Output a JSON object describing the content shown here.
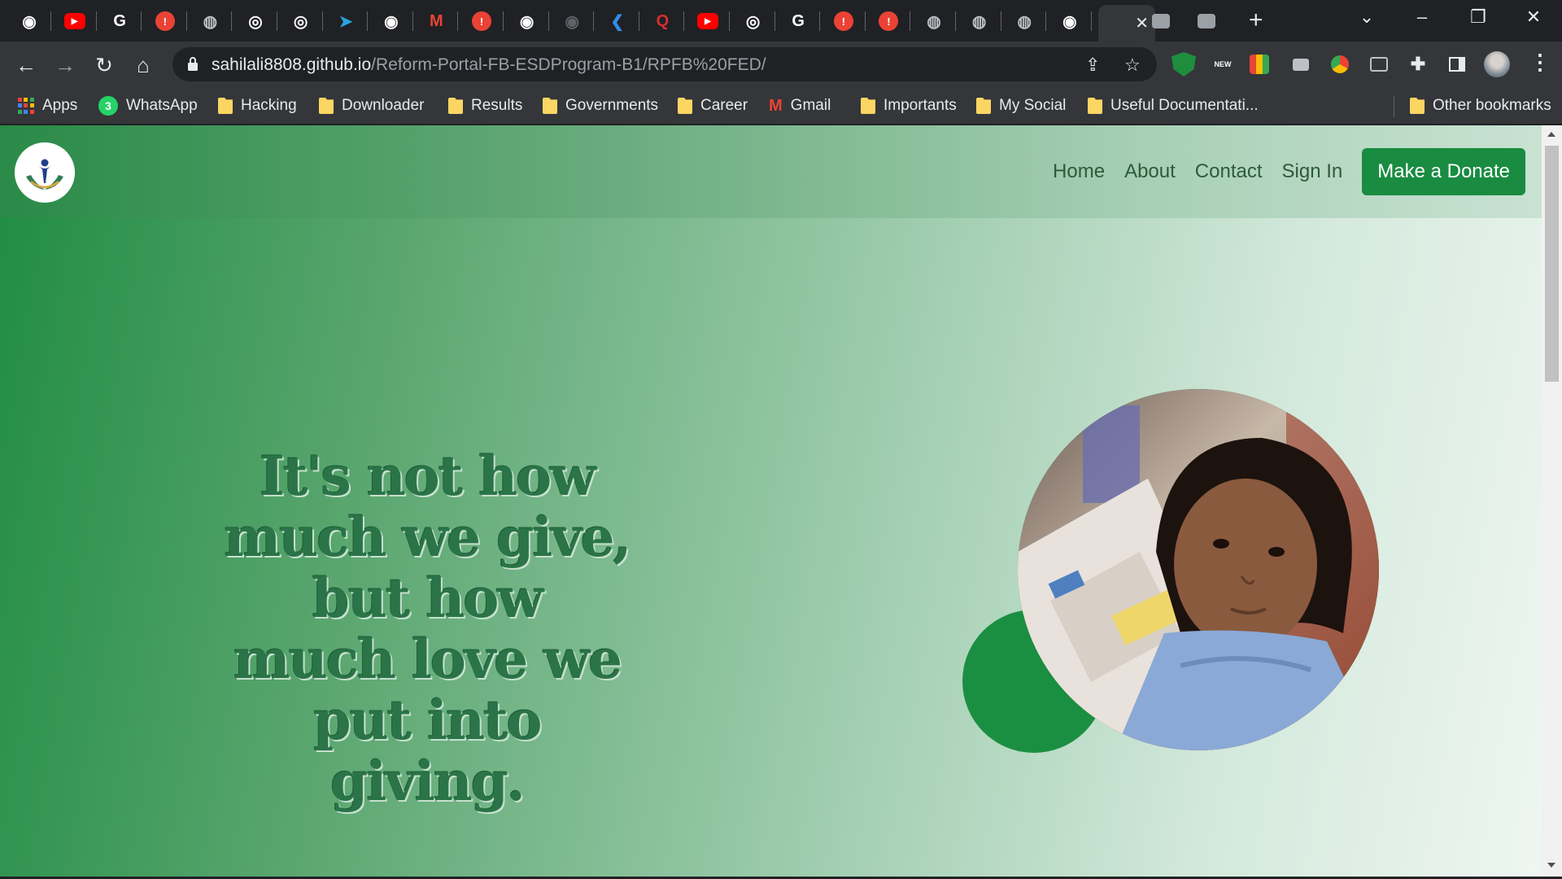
{
  "browser": {
    "tabs": [
      {
        "icon": "github-icon",
        "color": "#ffffff"
      },
      {
        "icon": "youtube-icon",
        "color": "#ff0000"
      },
      {
        "icon": "google-icon",
        "color": "#ffffff"
      },
      {
        "icon": "alert-icon",
        "color": "#ea4335"
      },
      {
        "icon": "globe-icon",
        "color": "#bdc1c6"
      },
      {
        "icon": "chrome-icon",
        "color": "#ffffff"
      },
      {
        "icon": "chrome-icon",
        "color": "#ffffff"
      },
      {
        "icon": "telegram-icon",
        "color": "#2aa3df"
      },
      {
        "icon": "github-icon",
        "color": "#ffffff"
      },
      {
        "icon": "gmail-icon",
        "color": "#ea4335"
      },
      {
        "icon": "alert-icon",
        "color": "#ea4335"
      },
      {
        "icon": "github-icon",
        "color": "#ffffff"
      },
      {
        "icon": "github-icon",
        "color": "#5f6368"
      },
      {
        "icon": "vscode-icon",
        "color": "#2f8ee8"
      },
      {
        "icon": "quora-icon",
        "color": "#d32f2f"
      },
      {
        "icon": "youtube-icon",
        "color": "#ff0000"
      },
      {
        "icon": "chrome-icon",
        "color": "#ffffff"
      },
      {
        "icon": "google-icon",
        "color": "#ffffff"
      },
      {
        "icon": "alert-icon",
        "color": "#ea4335"
      },
      {
        "icon": "alert-icon",
        "color": "#ea4335"
      },
      {
        "icon": "globe-icon",
        "color": "#bdc1c6"
      },
      {
        "icon": "globe-icon",
        "color": "#bdc1c6"
      },
      {
        "icon": "globe-icon",
        "color": "#bdc1c6"
      },
      {
        "icon": "github-icon",
        "color": "#ffffff"
      }
    ],
    "active_tab_close": "✕",
    "url_host": "sahilali8808.github.io",
    "url_path": "/Reform-Portal-FB-ESDProgram-B1/RPFB%20FED/"
  },
  "bookmarks": {
    "apps": "Apps",
    "items": [
      "WhatsApp",
      "Hacking",
      "Downloader",
      "Results",
      "Governments",
      "Career",
      "Gmail",
      "Importants",
      "My Social",
      "Useful Documentati..."
    ],
    "other": "Other bookmarks"
  },
  "site": {
    "nav": {
      "home": "Home",
      "about": "About",
      "contact": "Contact",
      "signin": "Sign In",
      "donate": "Make a Donate"
    },
    "quote_lines": [
      "It's not how",
      "much we give,",
      "but how",
      "much love we",
      "put into",
      "giving."
    ],
    "colors": {
      "brand_green": "#198c41",
      "quote_green": "#2a7448"
    }
  }
}
